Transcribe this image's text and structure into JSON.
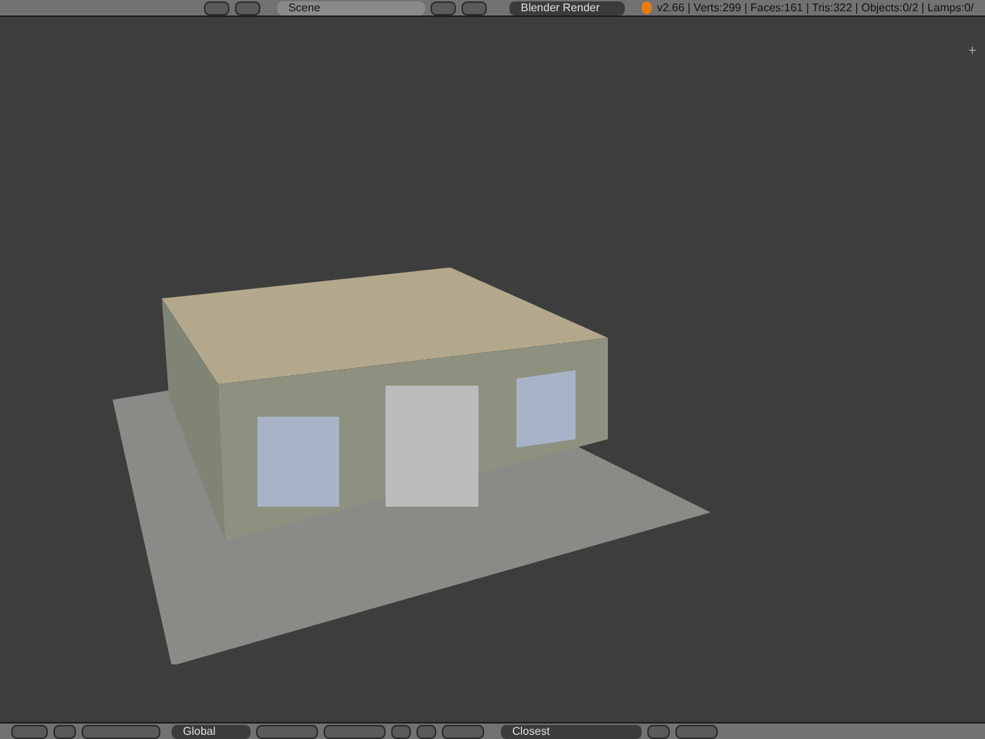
{
  "info_header": {
    "scene": "Scene",
    "render_engine": "Blender Render",
    "stats": "v2.66 | Verts:299 | Faces:161 | Tris:322 | Objects:0/2 | Lamps:0/"
  },
  "viewport": {
    "corner_widget": "+"
  },
  "view3d_header": {
    "orientation": "Global",
    "snap_target": "Closest"
  }
}
